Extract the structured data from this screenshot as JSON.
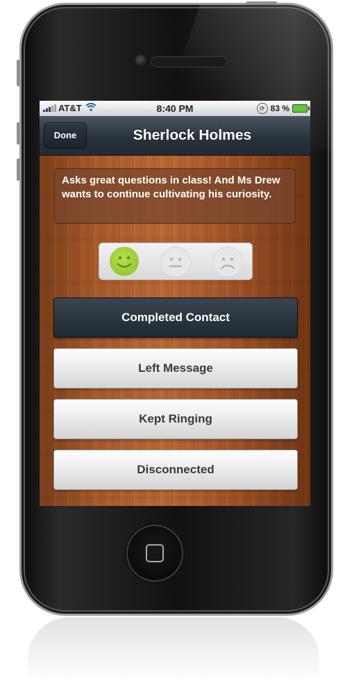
{
  "status_bar": {
    "carrier": "AT&T",
    "time": "8:40 PM",
    "battery": "83 %"
  },
  "nav": {
    "done_label": "Done",
    "title": "Sherlock Holmes"
  },
  "note": {
    "text": "Asks great questions in class! And Ms Drew wants to continue cultivating his curiosity."
  },
  "mood": {
    "selected": "happy",
    "options": [
      "happy",
      "neutral",
      "sad"
    ],
    "selected_color": "#9fd33c"
  },
  "buttons": {
    "completed": "Completed Contact",
    "left_message": "Left Message",
    "kept_ringing": "Kept Ringing",
    "disconnected": "Disconnected"
  }
}
